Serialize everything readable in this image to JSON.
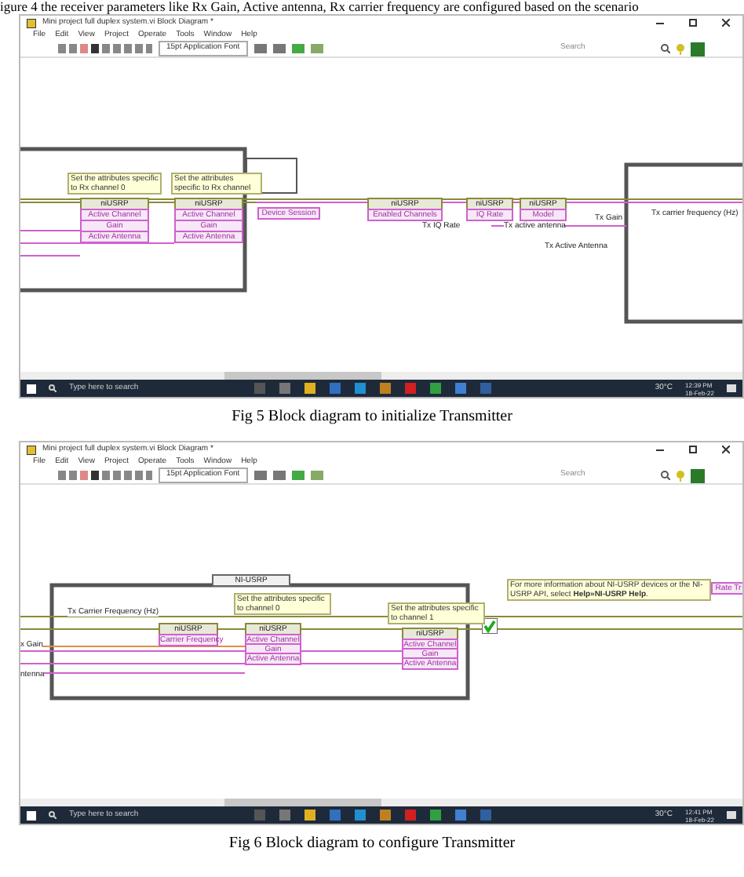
{
  "intro_text": "igure 4 the receiver parameters like Rx Gain, Active antenna, Rx carrier frequency are configured based on the scenario",
  "figures": [
    {
      "window": {
        "title": "Mini project full duplex system.vi Block Diagram *",
        "menu": [
          "File",
          "Edit",
          "View",
          "Project",
          "Operate",
          "Tools",
          "Window",
          "Help"
        ],
        "font_selector": "15pt Application Font",
        "search": {
          "placeholder": "Search"
        }
      },
      "diagram": [
        {
          "kind": "comment",
          "text": "Set the attributes specific to Rx channel 0"
        },
        {
          "kind": "comment",
          "text": "Set the attributes specific to Rx channel"
        },
        {
          "kind": "node",
          "text": "niUSRP"
        },
        {
          "kind": "property",
          "text": "Active Channel"
        },
        {
          "kind": "property",
          "text": "Gain"
        },
        {
          "kind": "property",
          "text": "Active Antenna"
        },
        {
          "kind": "node",
          "text": "niUSRP"
        },
        {
          "kind": "property",
          "text": "Active Channel"
        },
        {
          "kind": "property",
          "text": "Gain"
        },
        {
          "kind": "property",
          "text": "Active Antenna"
        },
        {
          "kind": "property",
          "text": "Device Session"
        },
        {
          "kind": "node",
          "text": "niUSRP"
        },
        {
          "kind": "property",
          "text": "Enabled Channels"
        },
        {
          "kind": "label",
          "text": "Tx IQ Rate"
        },
        {
          "kind": "node",
          "text": "niUSRP"
        },
        {
          "kind": "property",
          "text": "IQ Rate"
        },
        {
          "kind": "node",
          "text": "niUSRP"
        },
        {
          "kind": "property",
          "text": "Model"
        },
        {
          "kind": "label",
          "text": "Tx active antenna"
        },
        {
          "kind": "label",
          "text": "Tx Gain"
        },
        {
          "kind": "label",
          "text": "Tx Active Antenna"
        },
        {
          "kind": "label",
          "text": "Tx carrier frequency (Hz)"
        }
      ],
      "taskbar": {
        "search": {
          "placeholder": "Type here to search"
        },
        "temperature": "30°C",
        "time": "12:39 PM",
        "date": "18-Feb-22"
      },
      "caption": "Fig 5 Block diagram to initialize Transmitter"
    },
    {
      "window": {
        "title": "Mini project full duplex system.vi Block Diagram *",
        "menu": [
          "File",
          "Edit",
          "View",
          "Project",
          "Operate",
          "Tools",
          "Window",
          "Help"
        ],
        "font_selector": "15pt Application Font",
        "search": {
          "placeholder": "Search"
        }
      },
      "diagram": [
        {
          "kind": "selector",
          "text": "NI-USRP"
        },
        {
          "kind": "label",
          "text": "Tx Carrier Frequency (Hz)"
        },
        {
          "kind": "comment",
          "text": "Set the attributes specific to channel 0"
        },
        {
          "kind": "comment",
          "text": "Set the attributes specific to channel 1"
        },
        {
          "kind": "node",
          "text": "niUSRP"
        },
        {
          "kind": "property",
          "text": "Carrier Frequency"
        },
        {
          "kind": "node",
          "text": "niUSRP"
        },
        {
          "kind": "property",
          "text": "Active Channel"
        },
        {
          "kind": "property",
          "text": "Gain"
        },
        {
          "kind": "property",
          "text": "Active Antenna"
        },
        {
          "kind": "node",
          "text": "niUSRP"
        },
        {
          "kind": "property",
          "text": "Active Channel"
        },
        {
          "kind": "property",
          "text": "Gain"
        },
        {
          "kind": "property",
          "text": "Active Antenna"
        },
        {
          "kind": "label",
          "text": "x Gain"
        },
        {
          "kind": "label",
          "text": "ntenna"
        },
        {
          "kind": "comment",
          "text": "For more information about NI-USRP devices or the NI-USRP API, select **Help»NI-USRP Help**."
        },
        {
          "kind": "property",
          "text": "Rate Tr"
        }
      ],
      "taskbar": {
        "search": {
          "placeholder": "Type here to search"
        },
        "temperature": "30°C",
        "time": "12:41 PM",
        "date": "18-Feb-22"
      },
      "caption": "Fig 6 Block diagram to configure Transmitter"
    }
  ]
}
